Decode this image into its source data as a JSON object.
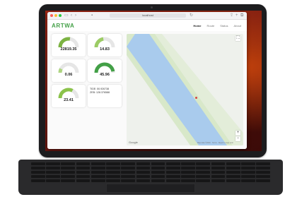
{
  "browser": {
    "address": "localhost"
  },
  "app": {
    "logo": "ARTWA",
    "nav": [
      {
        "label": "Home",
        "active": true
      },
      {
        "label": "Route",
        "active": false
      },
      {
        "label": "Status",
        "active": false
      },
      {
        "label": "About",
        "active": false
      }
    ]
  },
  "gauges": [
    {
      "label": "",
      "value": "22819.35",
      "level": 0.55,
      "color": "#7cb342"
    },
    {
      "label": "",
      "value": "14.83",
      "level": 0.45,
      "color": "#9ccc65"
    },
    {
      "label": "",
      "value": "0.06",
      "level": 0.15,
      "color": "#aed581"
    },
    {
      "label": "",
      "value": "45.96",
      "level": 0.95,
      "color": "#43a047"
    },
    {
      "label": "",
      "value": "23.41",
      "level": 0.65,
      "color": "#8bc34a"
    }
  ],
  "coordinates": {
    "line1": "TIDE: 50.926738",
    "line2": "ZEB: 128.376588"
  },
  "map": {
    "google_label": "Google",
    "attribution": "Map data ©2020 · Terms · Report a map error",
    "zoom_in": "+",
    "zoom_out": "−",
    "fullscreen": "⛶"
  },
  "colors": {
    "accent": "#43a047",
    "water": "#a9cbed",
    "wallpaper": "#8b1e12"
  }
}
